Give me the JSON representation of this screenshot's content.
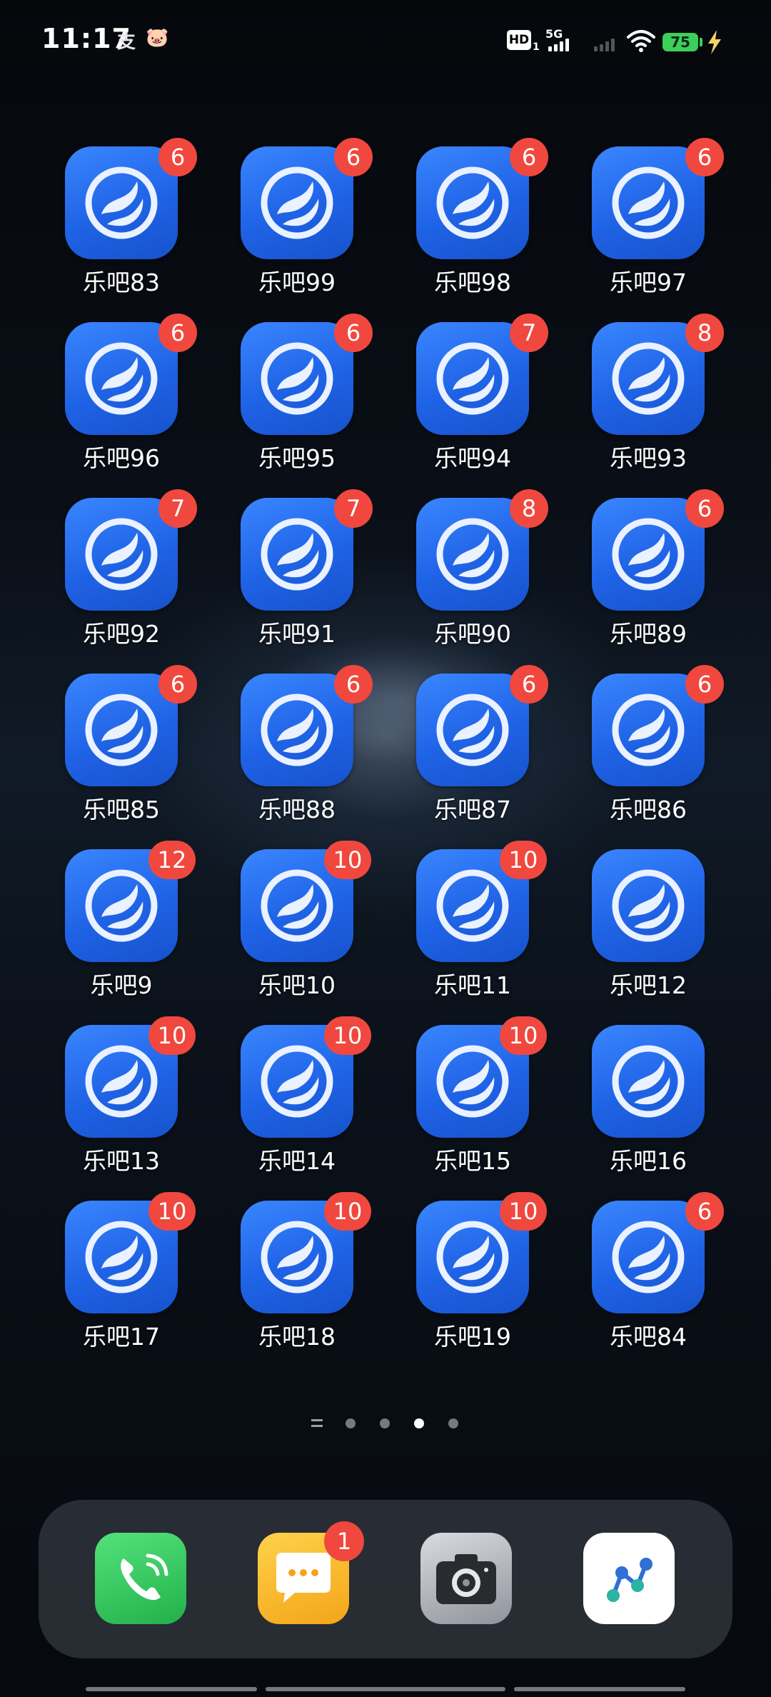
{
  "status_bar": {
    "time": "11:17",
    "notification_icons": [
      "支",
      "🐷"
    ],
    "hd_label": "HD",
    "hd_sub": "1",
    "network_label": "5G",
    "battery_level": "75"
  },
  "apps": [
    {
      "label": "乐吧83",
      "badge": "6"
    },
    {
      "label": "乐吧99",
      "badge": "6"
    },
    {
      "label": "乐吧98",
      "badge": "6"
    },
    {
      "label": "乐吧97",
      "badge": "6"
    },
    {
      "label": "乐吧96",
      "badge": "6"
    },
    {
      "label": "乐吧95",
      "badge": "6"
    },
    {
      "label": "乐吧94",
      "badge": "7"
    },
    {
      "label": "乐吧93",
      "badge": "8"
    },
    {
      "label": "乐吧92",
      "badge": "7"
    },
    {
      "label": "乐吧91",
      "badge": "7"
    },
    {
      "label": "乐吧90",
      "badge": "8"
    },
    {
      "label": "乐吧89",
      "badge": "6"
    },
    {
      "label": "乐吧85",
      "badge": "6"
    },
    {
      "label": "乐吧88",
      "badge": "6"
    },
    {
      "label": "乐吧87",
      "badge": "6"
    },
    {
      "label": "乐吧86",
      "badge": "6"
    },
    {
      "label": "乐吧9",
      "badge": "12"
    },
    {
      "label": "乐吧10",
      "badge": "10"
    },
    {
      "label": "乐吧11",
      "badge": "10"
    },
    {
      "label": "乐吧12",
      "badge": ""
    },
    {
      "label": "乐吧13",
      "badge": "10"
    },
    {
      "label": "乐吧14",
      "badge": "10"
    },
    {
      "label": "乐吧15",
      "badge": "10"
    },
    {
      "label": "乐吧16",
      "badge": ""
    },
    {
      "label": "乐吧17",
      "badge": "10"
    },
    {
      "label": "乐吧18",
      "badge": "10"
    },
    {
      "label": "乐吧19",
      "badge": "10"
    },
    {
      "label": "乐吧84",
      "badge": "6"
    }
  ],
  "page_indicator": {
    "pages": 5,
    "active_page": 4
  },
  "dock": {
    "apps": [
      {
        "name": "phone",
        "icon": "phone-icon"
      },
      {
        "name": "messages",
        "icon": "message-icon",
        "badge": "1"
      },
      {
        "name": "camera",
        "icon": "camera-icon"
      },
      {
        "name": "share",
        "icon": "share-icon"
      }
    ]
  }
}
